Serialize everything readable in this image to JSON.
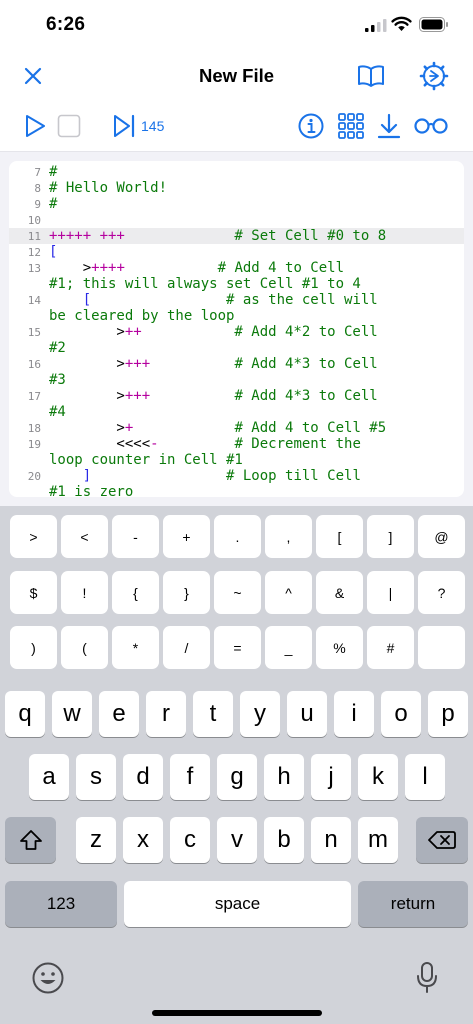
{
  "status_bar": {
    "time": "6:26"
  },
  "nav": {
    "title": "New File",
    "close_icon": "close-icon",
    "book_icon": "book-icon",
    "settings_icon": "settings-icon"
  },
  "toolbar": {
    "step_count": "145"
  },
  "colors": {
    "accent": "#1a73e8",
    "comment": "#0b7a0b",
    "operator": "#b4009e",
    "bracket": "#2a2ae6"
  },
  "editor": {
    "lines": [
      {
        "num": "7",
        "segments": [
          {
            "text": "#",
            "type": "comment"
          }
        ]
      },
      {
        "num": "8",
        "segments": [
          {
            "text": "# Hello World!",
            "type": "comment"
          }
        ]
      },
      {
        "num": "9",
        "segments": [
          {
            "text": "#",
            "type": "comment"
          }
        ]
      },
      {
        "num": "10",
        "segments": []
      },
      {
        "num": "11",
        "segments": [
          {
            "text": "+++++ +++",
            "type": "op"
          },
          {
            "text": "             # Set Cell #0 to 8",
            "type": "comment"
          }
        ]
      },
      {
        "num": "12",
        "segments": [
          {
            "text": "[",
            "type": "bracket"
          }
        ]
      },
      {
        "num": "13",
        "segments": [
          {
            "text": "    >",
            "type": "plain"
          },
          {
            "text": "++++",
            "type": "op"
          },
          {
            "text": "           # Add 4 to Cell",
            "type": "comment"
          }
        ]
      },
      {
        "num": "",
        "segments": [
          {
            "text": "#1; this will always set Cell #1 to 4",
            "type": "comment"
          }
        ]
      },
      {
        "num": "14",
        "segments": [
          {
            "text": "    [",
            "type": "bracket"
          },
          {
            "text": "                # as the cell will",
            "type": "comment"
          }
        ]
      },
      {
        "num": "",
        "segments": [
          {
            "text": "be cleared by the loop",
            "type": "comment"
          }
        ]
      },
      {
        "num": "15",
        "segments": [
          {
            "text": "        >",
            "type": "plain"
          },
          {
            "text": "++",
            "type": "op"
          },
          {
            "text": "           # Add 4*2 to Cell",
            "type": "comment"
          }
        ]
      },
      {
        "num": "",
        "segments": [
          {
            "text": "#2",
            "type": "comment"
          }
        ]
      },
      {
        "num": "16",
        "segments": [
          {
            "text": "        >",
            "type": "plain"
          },
          {
            "text": "+++",
            "type": "op"
          },
          {
            "text": "          # Add 4*3 to Cell",
            "type": "comment"
          }
        ]
      },
      {
        "num": "",
        "segments": [
          {
            "text": "#3",
            "type": "comment"
          }
        ]
      },
      {
        "num": "17",
        "segments": [
          {
            "text": "        >",
            "type": "plain"
          },
          {
            "text": "+++",
            "type": "op"
          },
          {
            "text": "          # Add 4*3 to Cell",
            "type": "comment"
          }
        ]
      },
      {
        "num": "",
        "segments": [
          {
            "text": "#4",
            "type": "comment"
          }
        ]
      },
      {
        "num": "18",
        "segments": [
          {
            "text": "        >",
            "type": "plain"
          },
          {
            "text": "+",
            "type": "op"
          },
          {
            "text": "            # Add 4 to Cell #5",
            "type": "comment"
          }
        ]
      },
      {
        "num": "19",
        "segments": [
          {
            "text": "        <<<<",
            "type": "plain"
          },
          {
            "text": "-",
            "type": "op"
          },
          {
            "text": "         # Decrement the",
            "type": "comment"
          }
        ]
      },
      {
        "num": "",
        "segments": [
          {
            "text": "loop counter in Cell #1",
            "type": "comment"
          }
        ]
      },
      {
        "num": "20",
        "segments": [
          {
            "text": "    ]",
            "type": "bracket"
          },
          {
            "text": "                # Loop till Cell",
            "type": "comment"
          }
        ]
      },
      {
        "num": "",
        "segments": [
          {
            "text": "#1 is zero",
            "type": "comment"
          }
        ]
      }
    ],
    "active_line": "11"
  },
  "symbol_rows": [
    [
      ">",
      "<",
      "-",
      "+",
      ".",
      ",",
      "[",
      "]",
      "@"
    ],
    [
      "$",
      "!",
      "{",
      "}",
      "~",
      "^",
      "&",
      "|",
      "?"
    ],
    [
      ")",
      "(",
      "*",
      "/",
      "=",
      "_",
      "%",
      "#",
      ""
    ]
  ],
  "keyboard": {
    "row1": [
      "q",
      "w",
      "e",
      "r",
      "t",
      "y",
      "u",
      "i",
      "o",
      "p"
    ],
    "row2": [
      "a",
      "s",
      "d",
      "f",
      "g",
      "h",
      "j",
      "k",
      "l"
    ],
    "row3": [
      "z",
      "x",
      "c",
      "v",
      "b",
      "n",
      "m"
    ],
    "numbers_label": "123",
    "space_label": "space",
    "return_label": "return"
  }
}
